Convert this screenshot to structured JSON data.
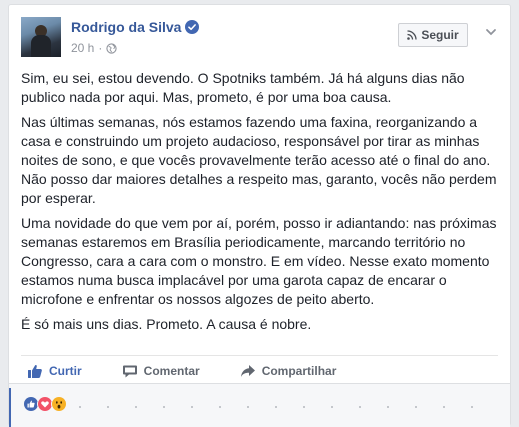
{
  "post": {
    "author": "Rodrigo da Silva",
    "time": "20 h",
    "dot": "·",
    "follow_label": "Seguir",
    "paragraphs": [
      "Sim, eu sei, estou devendo. O Spotniks também. Já há alguns dias não publico nada por aqui. Mas, prometo, é por uma boa causa.",
      "Nas últimas semanas, nós estamos fazendo uma faxina, reorganizando a casa e construindo um projeto audacioso, responsável por tirar as minhas noites de sono, e que vocês provavelmente terão acesso até o final do ano. Não posso dar maiores detalhes a respeito mas, garanto, vocês não perdem por esperar.",
      "Uma novidade do que vem por aí, porém, posso ir adiantando: nas próximas semanas estaremos em Brasília periodicamente, marcando território no Congresso, cara a cara com o monstro. E em vídeo. Nesse exato momento estamos numa busca implacável por uma garota capaz de encarar o microfone e enfrentar os nossos algozes de peito aberto.",
      "É só mais uns dias. Prometo. A causa é nobre."
    ]
  },
  "actions": {
    "like": "Curtir",
    "comment": "Comentar",
    "share": "Compartilhar"
  },
  "reactions": [
    "like-reaction",
    "love-reaction",
    "wow-reaction"
  ],
  "colors": {
    "name_link": "#365899",
    "like_blue": "#4267b2",
    "verified": "#4267b2",
    "love": "#f25268",
    "wow": "#f7b125"
  }
}
